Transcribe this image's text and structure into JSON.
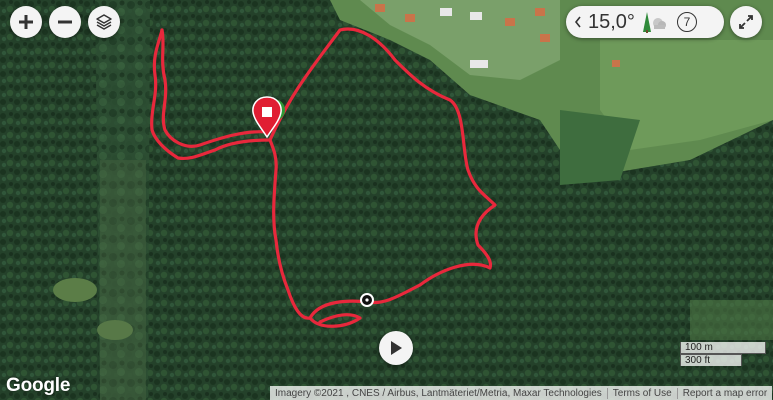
{
  "map": {
    "controls": {
      "zoom_in_icon": "plus-icon",
      "zoom_out_icon": "minus-icon",
      "layers_icon": "layers-icon",
      "fullscreen_icon": "expand-icon"
    },
    "weather": {
      "temperature": "15,0°",
      "forecast_days": "7",
      "prev_icon": "chevron-left-icon",
      "weather_icon": "partly-cloudy-icon"
    },
    "route": {
      "color": "#e8283c",
      "start_marker_color": "#e01e32",
      "end_marker_color": "#2e9a36",
      "current_position_icon": "position-dot-icon"
    },
    "player": {
      "play_icon": "play-icon"
    },
    "scale": {
      "metric": "100 m",
      "imperial": "300 ft"
    },
    "branding": {
      "logo": "Google"
    },
    "attribution": {
      "imagery": "Imagery ©2021 , CNES / Airbus, Lantmäteriet/Metria, Maxar Technologies",
      "terms": "Terms of Use",
      "report": "Report a map error"
    }
  }
}
